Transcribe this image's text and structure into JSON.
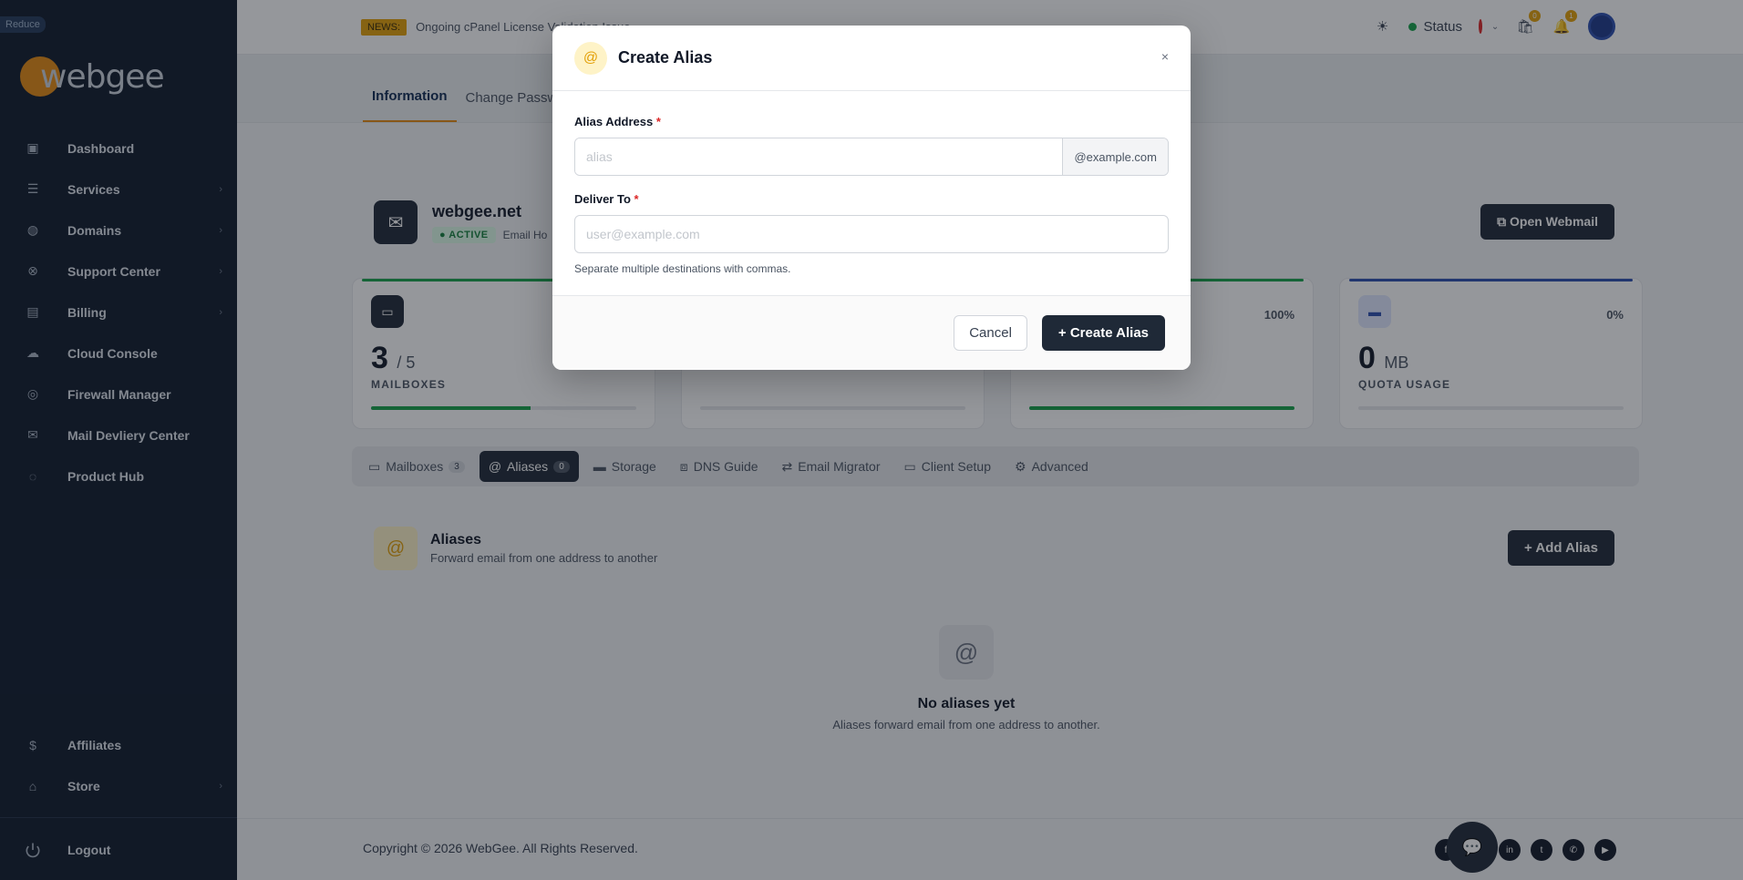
{
  "sidebar": {
    "reduce_label": "Reduce",
    "logo_text": "webgee",
    "items": [
      {
        "label": "Dashboard",
        "icon": "dashboard-icon",
        "has_children": false
      },
      {
        "label": "Services",
        "icon": "services-icon",
        "has_children": true
      },
      {
        "label": "Domains",
        "icon": "globe-icon",
        "has_children": true
      },
      {
        "label": "Support Center",
        "icon": "lifebuoy-icon",
        "has_children": true
      },
      {
        "label": "Billing",
        "icon": "billing-icon",
        "has_children": true
      },
      {
        "label": "Cloud Console",
        "icon": "cloud-icon",
        "has_children": false
      },
      {
        "label": "Firewall Manager",
        "icon": "firewall-icon",
        "has_children": false
      },
      {
        "label": "Mail Devliery Center",
        "icon": "mail-delivery-icon",
        "has_children": false
      },
      {
        "label": "Product Hub",
        "icon": "chat-bubbles-icon",
        "has_children": false
      }
    ],
    "bottom_items": [
      {
        "label": "Affiliates",
        "icon": "dollar-icon",
        "has_children": false
      },
      {
        "label": "Store",
        "icon": "store-icon",
        "has_children": true
      }
    ],
    "logout_label": "Logout"
  },
  "topbar": {
    "news_badge": "NEWS:",
    "news_text": "Ongoing cPanel License Validation Issue",
    "status_label": "Status",
    "cart_count": "0",
    "notif_count": "1"
  },
  "tabs_top": [
    {
      "label": "Information",
      "active": true
    },
    {
      "label": "Change Passw",
      "active": false
    }
  ],
  "domain": {
    "name": "webgee.net",
    "status": "ACTIVE",
    "product": "Email Ho",
    "open_webmail": "Open Webmail"
  },
  "stats": [
    {
      "value": "3",
      "total": "/ 5",
      "unit": "",
      "label": "MAILBOXES",
      "pct": "",
      "progress": 0.6,
      "color": "#16a34a"
    },
    {
      "value": "",
      "total": "",
      "unit": "",
      "label": "ALIASES",
      "pct": "",
      "progress": 0,
      "color": "#e3a008"
    },
    {
      "value": "",
      "total": "",
      "unit": "",
      "label": "ACTIVE ACCOUNTS",
      "pct": "100%",
      "progress": 1.0,
      "color": "#16a34a"
    },
    {
      "value": "0",
      "total": "",
      "unit": "MB",
      "label": "QUOTA USAGE",
      "pct": "0%",
      "progress": 0,
      "color": "#2c4fb0"
    }
  ],
  "subtabs": [
    {
      "label": "Mailboxes",
      "count": "3",
      "icon": "inbox-icon",
      "active": false
    },
    {
      "label": "Aliases",
      "count": "0",
      "icon": "at-icon",
      "active": true
    },
    {
      "label": "Storage",
      "count": "",
      "icon": "storage-icon",
      "active": false
    },
    {
      "label": "DNS Guide",
      "count": "",
      "icon": "network-icon",
      "active": false
    },
    {
      "label": "Email Migrator",
      "count": "",
      "icon": "swap-icon",
      "active": false
    },
    {
      "label": "Client Setup",
      "count": "",
      "icon": "laptop-icon",
      "active": false
    },
    {
      "label": "Advanced",
      "count": "",
      "icon": "gear-icon",
      "active": false
    }
  ],
  "aliases_section": {
    "title": "Aliases",
    "subtitle": "Forward email from one address to another",
    "add_button": "Add Alias",
    "empty_title": "No aliases yet",
    "empty_subtitle": "Aliases forward email from one address to another."
  },
  "footer": {
    "copyright": "Copyright © 2026 WebGee. All Rights Reserved.",
    "socials": [
      "facebook-icon",
      "instagram-icon",
      "linkedin-icon",
      "twitter-icon",
      "whatsapp-icon",
      "youtube-icon"
    ]
  },
  "modal": {
    "title": "Create Alias",
    "close": "×",
    "alias_label": "Alias Address",
    "alias_placeholder": "alias",
    "alias_value": "",
    "alias_suffix": "@example.com",
    "deliver_label": "Deliver To",
    "deliver_placeholder": "user@example.com",
    "deliver_value": "",
    "helper": "Separate multiple destinations with commas.",
    "cancel": "Cancel",
    "create": "Create Alias"
  },
  "colors": {
    "sidebar_bg": "#0f1a2b",
    "accent": "#e58a12",
    "primary_dark": "#1f2937",
    "success": "#16a34a",
    "required": "#dc2626"
  }
}
